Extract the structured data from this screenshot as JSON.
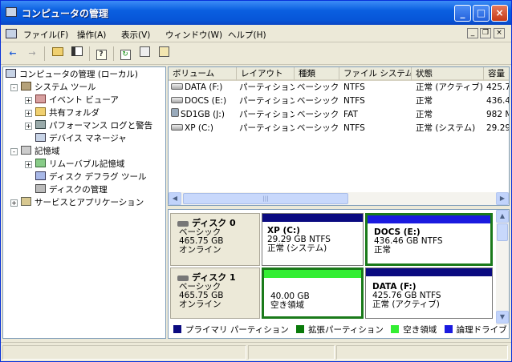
{
  "window": {
    "title": "コンピュータの管理",
    "controls": {
      "minimize": "_",
      "maximize": "□",
      "close": "×"
    }
  },
  "menubar": {
    "items": [
      "ファイル(F)",
      "操作(A)",
      "表示(V)",
      "ウィンドウ(W)",
      "ヘルプ(H)"
    ],
    "mdi": {
      "minimize": "_",
      "restore": "❐",
      "close": "×"
    }
  },
  "toolbar": {
    "icons": [
      "back-arrow-icon",
      "forward-arrow-icon",
      "up-folder-icon",
      "show-hide-tree-icon",
      "help-icon",
      "refresh-icon",
      "properties-icon",
      "export-icon"
    ]
  },
  "tree": {
    "root": "コンピュータの管理 (ローカル)",
    "items": [
      {
        "label": "システム ツール",
        "expander": "-"
      },
      {
        "label": "イベント ビューア",
        "expander": "+"
      },
      {
        "label": "共有フォルダ",
        "expander": "+"
      },
      {
        "label": "パフォーマンス ログと警告",
        "expander": "+"
      },
      {
        "label": "デバイス マネージャ",
        "expander": ""
      },
      {
        "label": "記憶域",
        "expander": "-"
      },
      {
        "label": "リムーバブル記憶域",
        "expander": "+"
      },
      {
        "label": "ディスク デフラグ ツール",
        "expander": ""
      },
      {
        "label": "ディスクの管理",
        "expander": ""
      },
      {
        "label": "サービスとアプリケーション",
        "expander": "+"
      }
    ]
  },
  "volumes": {
    "columns": [
      "ボリューム",
      "レイアウト",
      "種類",
      "ファイル システム",
      "状態",
      "容量"
    ],
    "rows": [
      {
        "volume": "DATA (F:)",
        "layout": "パーティション",
        "type": "ベーシック",
        "fs": "NTFS",
        "status": "正常 (アクティブ)",
        "capacity": "425.7"
      },
      {
        "volume": "DOCS (E:)",
        "layout": "パーティション",
        "type": "ベーシック",
        "fs": "NTFS",
        "status": "正常",
        "capacity": "436.4"
      },
      {
        "volume": "SD1GB (J:)",
        "layout": "パーティション",
        "type": "ベーシック",
        "fs": "FAT",
        "status": "正常",
        "capacity": "982 M"
      },
      {
        "volume": "XP (C:)",
        "layout": "パーティション",
        "type": "ベーシック",
        "fs": "NTFS",
        "status": "正常 (システム)",
        "capacity": "29.29"
      }
    ],
    "scroll_grip": "|||"
  },
  "disks": [
    {
      "name": "ディスク 0",
      "type": "ベーシック",
      "size": "465.75 GB",
      "state": "オンライン",
      "partitions": [
        {
          "name": "XP  (C:)",
          "size": "29.29 GB NTFS",
          "status": "正常 (システム)",
          "bar": "#0a0a80",
          "selected": false
        },
        {
          "name": "DOCS  (E:)",
          "size": "436.46 GB NTFS",
          "status": "正常",
          "bar": "#1a1adf",
          "selected": true
        }
      ]
    },
    {
      "name": "ディスク 1",
      "type": "ベーシック",
      "size": "465.75 GB",
      "state": "オンライン",
      "partitions": [
        {
          "name": "",
          "size": "40.00 GB",
          "status": "空き領域",
          "bar": "#33ee33",
          "selected": true
        },
        {
          "name": "DATA  (F:)",
          "size": "425.76 GB NTFS",
          "status": "正常 (アクティブ)",
          "bar": "#0a0a80",
          "selected": false
        }
      ]
    }
  ],
  "legend": [
    {
      "label": "プライマリ パーティション",
      "color": "#0a0a80"
    },
    {
      "label": "拡張パーティション",
      "color": "#0a7a0a"
    },
    {
      "label": "空き領域",
      "color": "#33ee33"
    },
    {
      "label": "論理ドライブ",
      "color": "#1a1adf"
    }
  ],
  "colors": {
    "selection_border": "#1a7a1a"
  }
}
